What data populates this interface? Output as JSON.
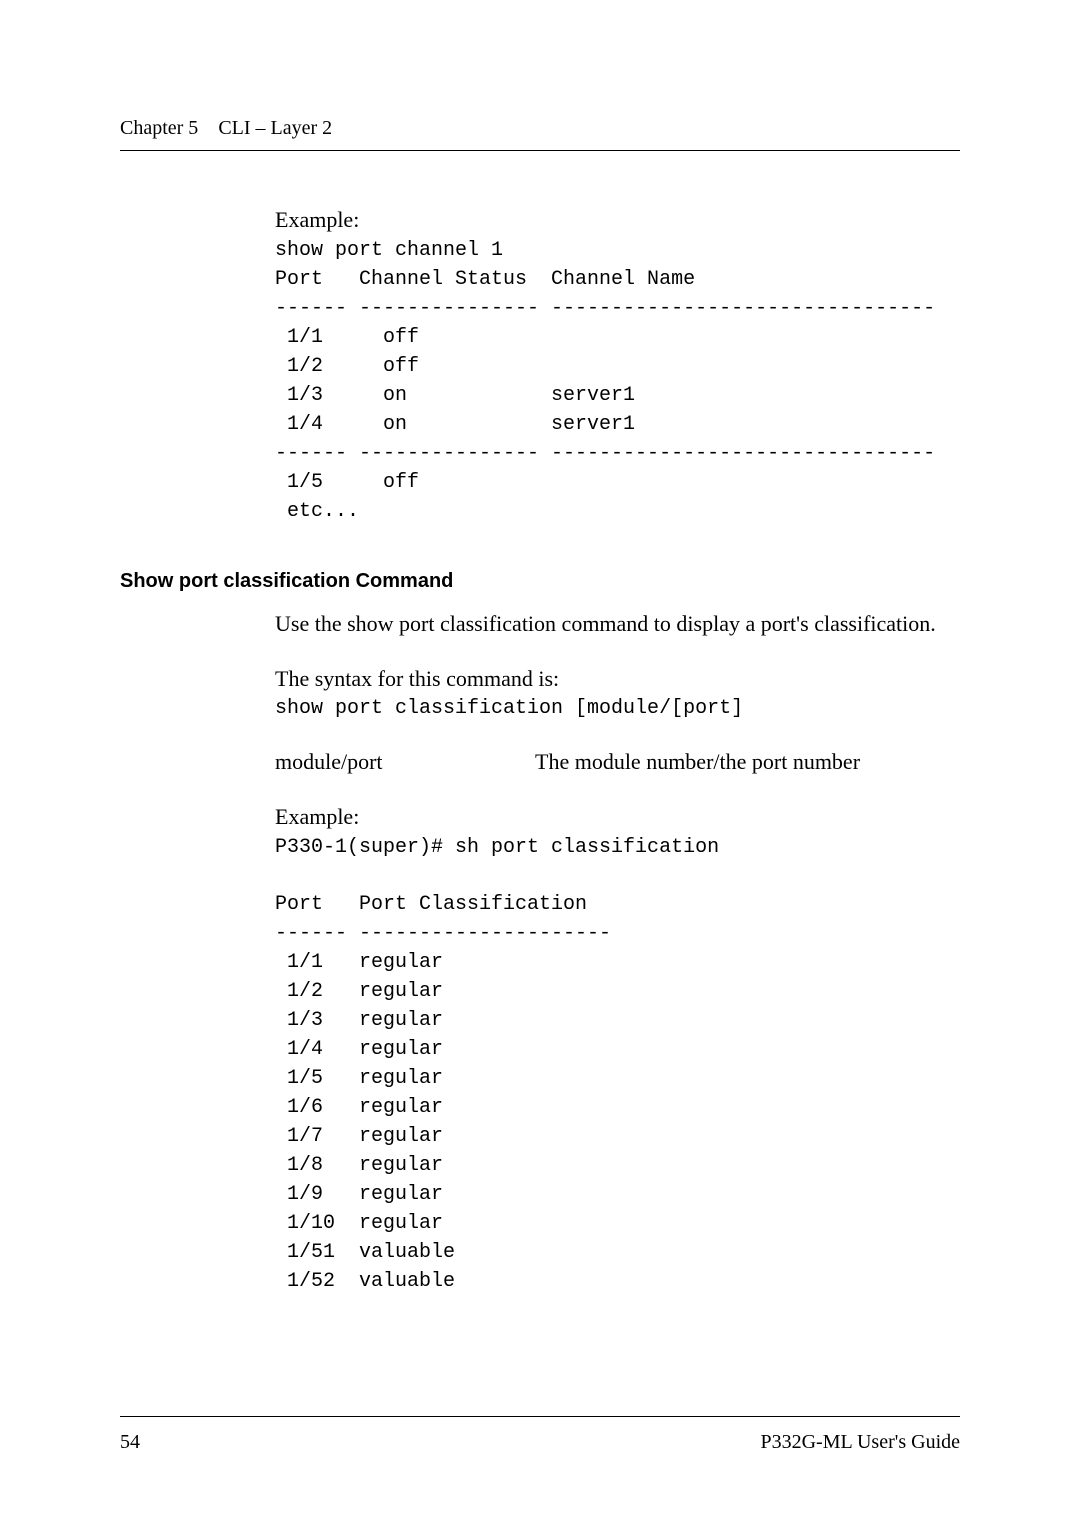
{
  "header": {
    "chapter": "Chapter 5",
    "title": "CLI – Layer 2"
  },
  "example1": {
    "label": "Example:",
    "block": "show port channel 1\nPort   Channel Status  Channel Name\n------ --------------- --------------------------------\n 1/1     off\n 1/2     off\n 1/3     on            server1\n 1/4     on            server1\n------ --------------- --------------------------------\n 1/5     off\n etc..."
  },
  "section": {
    "heading": "Show port classification Command",
    "body1": "Use the show port classification command to display a port's classification.",
    "body2": "The syntax for this command is:",
    "syntax": "show port classification [module/[port]",
    "param_name": " module/port",
    "param_desc": "The module number/the port number"
  },
  "example2": {
    "label": "Example:",
    "cmd": "P330-1(super)# sh port classification",
    "table": "Port   Port Classification\n------ ---------------------\n 1/1   regular\n 1/2   regular\n 1/3   regular\n 1/4   regular\n 1/5   regular\n 1/6   regular\n 1/7   regular\n 1/8   regular\n 1/9   regular\n 1/10  regular\n 1/51  valuable\n 1/52  valuable"
  },
  "footer": {
    "page": "54",
    "doc": "P332G-ML User's Guide"
  }
}
